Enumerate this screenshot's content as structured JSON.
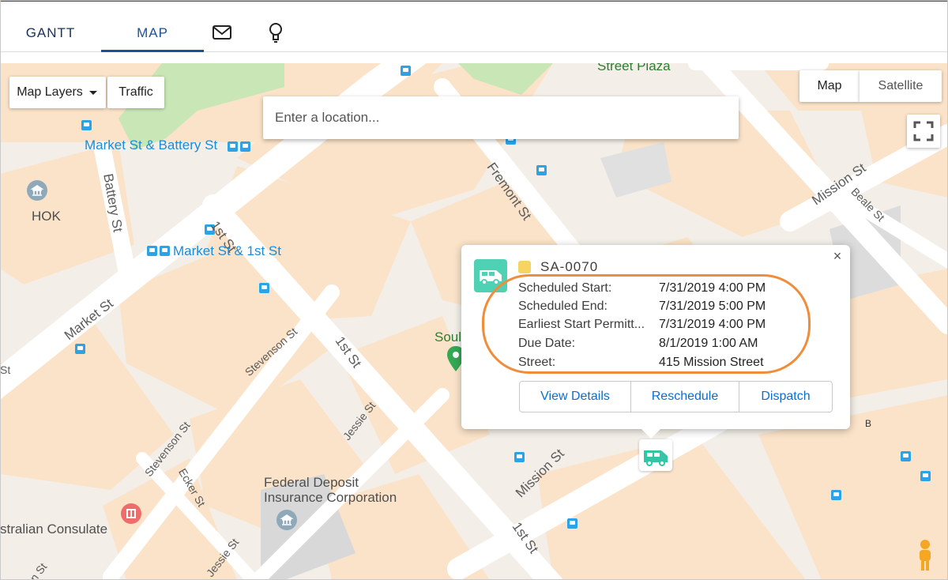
{
  "tabs": {
    "gantt": "GANTT",
    "map": "MAP"
  },
  "controls": {
    "map_layers": "Map Layers",
    "traffic": "Traffic",
    "map": "Map",
    "satellite": "Satellite",
    "search_placeholder": "Enter a location..."
  },
  "labels": {
    "street_plaza": "Street Plaza",
    "market_battery": "Market St & Battery St",
    "battery_st": "Battery St",
    "hok": "HOK",
    "first_st_a": "1st St",
    "market_first": "Market St & 1st St",
    "market_st": "Market St",
    "fremont_st": "Fremont St",
    "mission_st_top": "Mission St",
    "beale_st": "Beale St",
    "stevenson_a": "Stevenson St",
    "stevenson_b": "Stevenson St",
    "first_st_b": "1st St",
    "first_st_c": "1st St",
    "jessie_a": "Jessie St",
    "jessie_b": "Jessie St",
    "ecker_st": "Ecker St",
    "mission_st_mid": "Mission St",
    "fdic_1": "Federal Deposit",
    "fdic_2": "Insurance Corporation",
    "consulate": "stralian Consulate",
    "soul": "Soul",
    "st_left": "St",
    "st_bottom_left": "on St",
    "letter_b": "B"
  },
  "popup": {
    "id": "SA-0070",
    "rows": [
      {
        "label": "Scheduled Start:",
        "value": "7/31/2019 4:00 PM"
      },
      {
        "label": "Scheduled End:",
        "value": "7/31/2019 5:00 PM"
      },
      {
        "label": "Earliest Start Permitt...",
        "value": "7/31/2019 4:00 PM"
      },
      {
        "label": "Due Date:",
        "value": "8/1/2019 1:00 AM"
      },
      {
        "label": "Street:",
        "value": "415 Mission Street"
      }
    ],
    "buttons": {
      "view_details": "View Details",
      "reschedule": "Reschedule",
      "dispatch": "Dispatch"
    },
    "close": "×"
  },
  "colors": {
    "accent": "#1b5297",
    "vehicle": "#4fd2b4",
    "status_dot": "#f7d363",
    "highlight": "#f08c3a",
    "link": "#0a6ed1"
  },
  "icons": [
    "envelope-icon",
    "lightbulb-icon",
    "fullscreen-icon",
    "pegman-icon",
    "caret-down-icon",
    "van-icon",
    "bus-stop-icon",
    "museum-icon",
    "consulate-icon",
    "location-pin-icon"
  ]
}
